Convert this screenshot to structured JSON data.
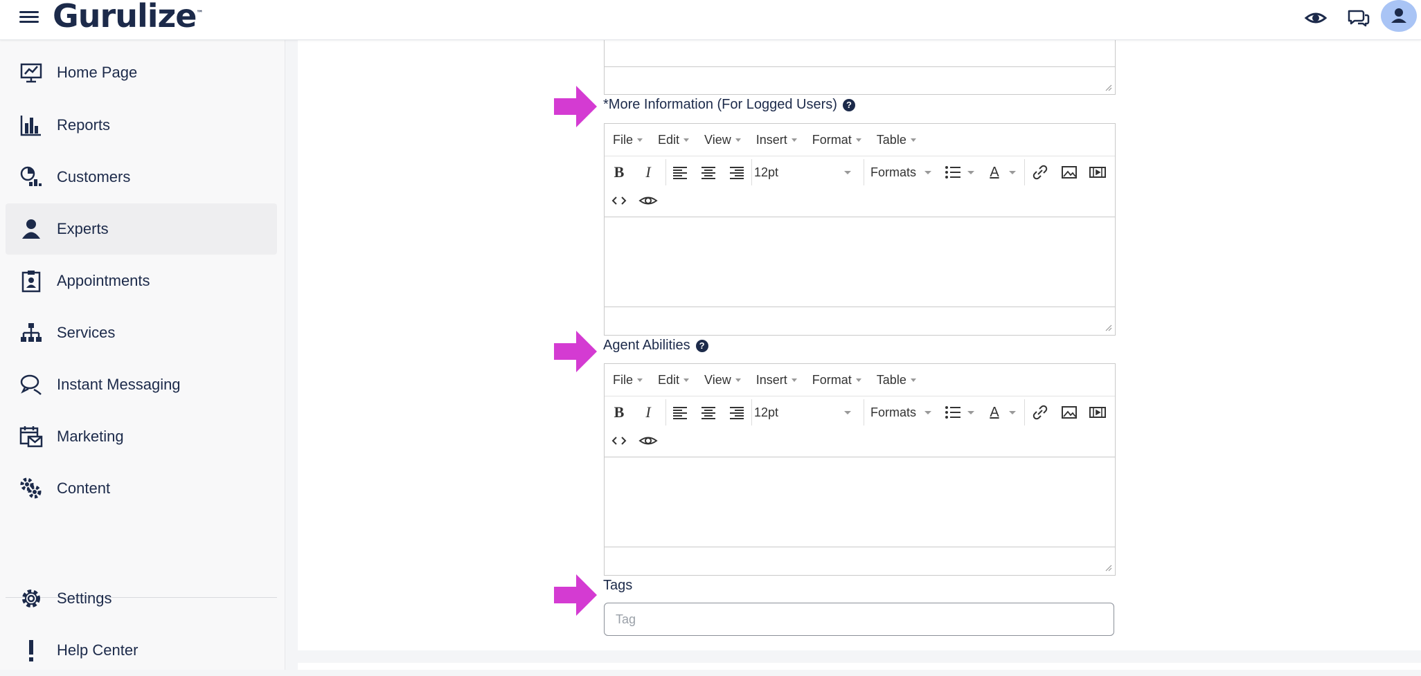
{
  "app": {
    "logo_text": "Gurulize",
    "logo_mark": "™"
  },
  "colors": {
    "brand": "#1c2a4a",
    "arrow": "#d43bd2",
    "avatar": "#a9c4f5"
  },
  "topbar": {
    "icons": [
      "menu-icon",
      "eye-icon",
      "chat-icon",
      "user-icon"
    ]
  },
  "sidebar": {
    "items": [
      {
        "label": "Home Page",
        "icon": "monitor-chart-icon"
      },
      {
        "label": "Reports",
        "icon": "bar-chart-icon"
      },
      {
        "label": "Customers",
        "icon": "pie-users-icon"
      },
      {
        "label": "Experts",
        "icon": "person-icon",
        "active": true
      },
      {
        "label": "Appointments",
        "icon": "clipboard-user-icon"
      },
      {
        "label": "Services",
        "icon": "sitemap-icon"
      },
      {
        "label": "Instant Messaging",
        "icon": "chat-bubble-icon"
      },
      {
        "label": "Marketing",
        "icon": "calendar-mail-icon"
      },
      {
        "label": "Content",
        "icon": "gears-icon"
      }
    ],
    "bottom": [
      {
        "label": "Settings",
        "icon": "settings-gear-icon"
      },
      {
        "label": "Help Center",
        "icon": "exclamation-icon"
      }
    ]
  },
  "form": {
    "more_info": {
      "label": "*More Information (For Logged Users)",
      "help": "?"
    },
    "agent_abilities": {
      "label": "Agent Abilities",
      "help": "?"
    },
    "tags": {
      "label": "Tags",
      "placeholder": "Tag"
    }
  },
  "editor": {
    "menus": [
      "File",
      "Edit",
      "View",
      "Insert",
      "Format",
      "Table"
    ],
    "bold": "B",
    "italic": "I",
    "font_size": "12pt",
    "formats_label": "Formats",
    "color_letter": "A"
  }
}
